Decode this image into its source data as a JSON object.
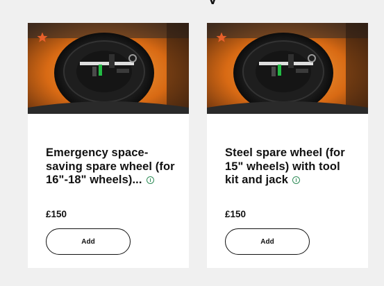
{
  "colors": {
    "accent_orange": "#e8602a",
    "info_green": "#2e8b57",
    "card_bg": "#ffffff",
    "page_bg": "#f0f0f0"
  },
  "products": [
    {
      "title": "Emergency space-saving spare wheel (for 16\"-18\" wheels)...",
      "price": "£150",
      "add_label": "Add",
      "image_icon": "star-icon",
      "info_icon": "info-icon"
    },
    {
      "title": "Steel spare wheel (for 15\" wheels) with tool kit and jack",
      "price": "£150",
      "add_label": "Add",
      "image_icon": "star-icon",
      "info_icon": "info-icon"
    }
  ]
}
